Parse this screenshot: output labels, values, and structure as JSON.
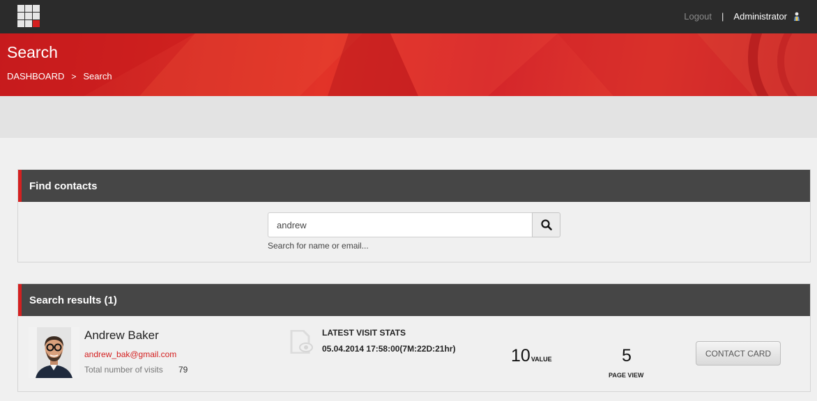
{
  "header": {
    "logout_label": "Logout",
    "separator": "|",
    "username": "Administrator"
  },
  "hero": {
    "title": "Search",
    "breadcrumb": [
      "DASHBOARD",
      "Search"
    ],
    "breadcrumb_separator": ">"
  },
  "find_contacts": {
    "title": "Find contacts",
    "search_value": "andrew",
    "hint": "Search for name or email..."
  },
  "search_results": {
    "title": "Search results (1)",
    "items": [
      {
        "name": "Andrew Baker",
        "email": "andrew_bak@gmail.com",
        "visits_label": "Total number of visits",
        "visits_count": "79",
        "stats_title": "LATEST VISIT STATS",
        "stats_value": "05.04.2014 17:58:00(7M:22D:21hr)",
        "value_number": "10",
        "value_label": "VALUE",
        "page_view_number": "5",
        "page_view_label": "PAGE VIEW",
        "contact_card_label": "CONTACT CARD"
      }
    ]
  },
  "icons": {
    "logo": "grid-logo-icon",
    "user": "user-icon",
    "search": "search-icon",
    "document": "document-view-icon"
  },
  "colors": {
    "accent": "#d42020",
    "topbar": "#2b2b2b",
    "panel_header": "#464646"
  }
}
